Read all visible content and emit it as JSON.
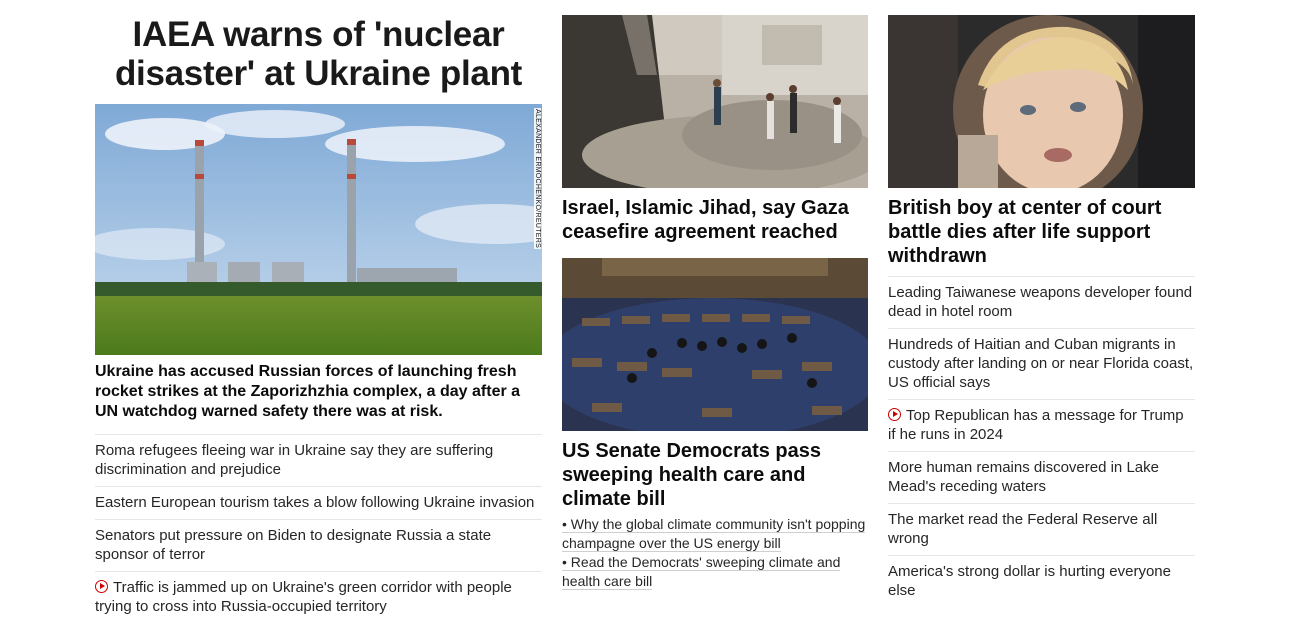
{
  "lead": {
    "headline_line1": "IAEA warns of 'nuclear",
    "headline_line2": "disaster' at Ukraine plant",
    "photo_credit": "ALEXANDER ERMOCHENKO/REUTERS",
    "description": "Ukraine has accused Russian forces of launching fresh rocket strikes at the Zaporizhzhia complex, a day after a UN watchdog warned safety there was at risk.",
    "related": [
      {
        "text": "Roma refugees fleeing war in Ukraine say they are suffering discrimination and prejudice",
        "video": false
      },
      {
        "text": "Eastern European tourism takes a blow following Ukraine invasion",
        "video": false
      },
      {
        "text": "Senators put pressure on Biden to designate Russia a state sponsor of terror",
        "video": false
      },
      {
        "text": "Traffic is jammed up on Ukraine's green corridor with people trying to cross into Russia-occupied territory",
        "video": true
      }
    ]
  },
  "middle": {
    "story1": {
      "headline": "Israel, Islamic Jihad, say Gaza ceasefire agreement reached"
    },
    "story2": {
      "headline": "US Senate Democrats pass sweeping health care and climate bill",
      "links": [
        "• Why the global climate community isn't popping champagne over the US energy bill",
        "• Read the Democrats' sweeping climate and health care bill"
      ]
    }
  },
  "right": {
    "headline": "British boy at center of court battle dies after life support withdrawn",
    "list": [
      {
        "text": "Leading Taiwanese weapons developer found dead in hotel room",
        "video": false
      },
      {
        "text": "Hundreds of Haitian and Cuban migrants in custody after landing on or near Florida coast, US official says",
        "video": false
      },
      {
        "text": "Top Republican has a message for Trump if he runs in 2024",
        "video": true
      },
      {
        "text": "More human remains discovered in Lake Mead's receding waters",
        "video": false
      },
      {
        "text": "The market read the Federal Reserve all wrong",
        "video": false
      },
      {
        "text": "America's strong dollar is hurting everyone else",
        "video": false
      }
    ]
  },
  "colors": {
    "accent_red": "#cc0000",
    "text": "#0c0c0c",
    "divider": "#e6e6e6"
  },
  "icons": {
    "video": "play-circle-icon"
  }
}
